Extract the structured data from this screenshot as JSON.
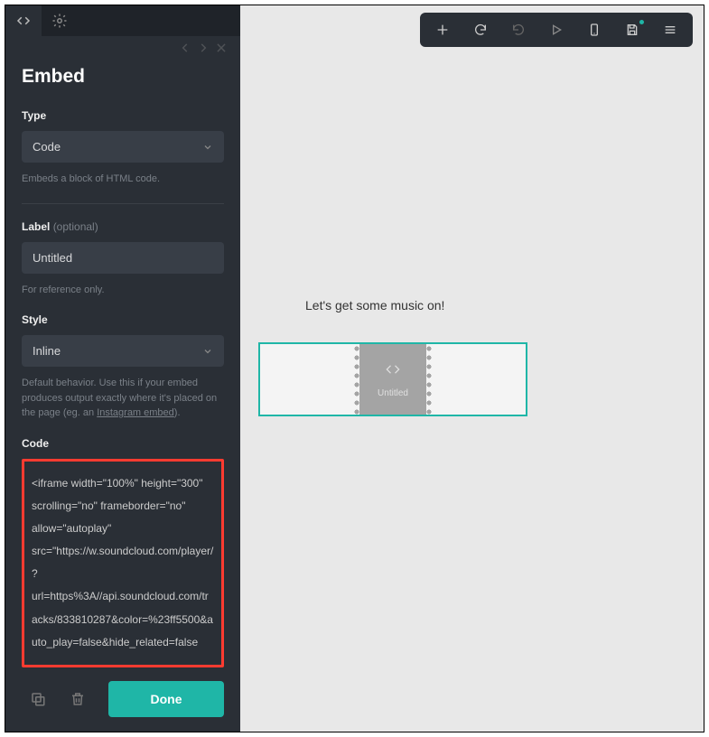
{
  "panel": {
    "title": "Embed",
    "type_label": "Type",
    "type_value": "Code",
    "type_help": "Embeds a block of HTML code.",
    "label_label": "Label",
    "label_optional": "(optional)",
    "label_value": "Untitled",
    "label_help": "For reference only.",
    "style_label": "Style",
    "style_value": "Inline",
    "style_help_1": "Default behavior. Use this if your embed produces output exactly where it's placed on the page (eg. an ",
    "style_help_link": "Instagram embed",
    "style_help_2": ").",
    "code_label": "Code",
    "code_value": "<iframe width=\"100%\" height=\"300\" scrolling=\"no\" frameborder=\"no\" allow=\"autoplay\" src=\"https://w.soundcloud.com/player/?url=https%3A//api.soundcloud.com/tracks/833810287&color=%23ff5500&auto_play=false&hide_related=false",
    "done": "Done"
  },
  "canvas": {
    "text": "Let's get some music on!",
    "embed_label": "Untitled"
  }
}
